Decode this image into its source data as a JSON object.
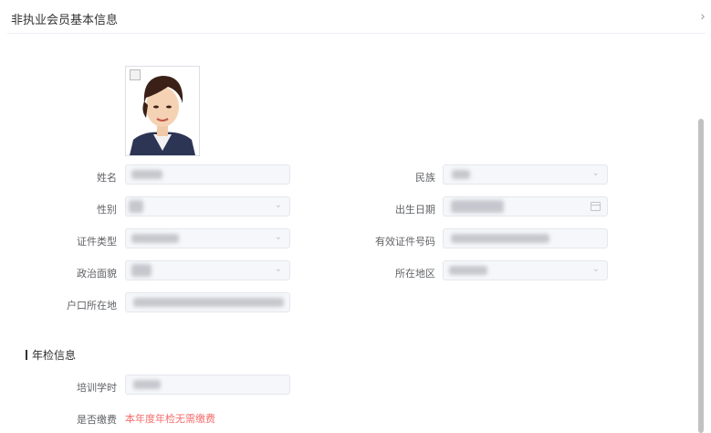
{
  "header": {
    "title": "非执业会员基本信息",
    "collapse_icon": "chevron-right-icon"
  },
  "photo": {
    "alt": "",
    "icon": "member-photo"
  },
  "fields": {
    "name": {
      "label": "姓名"
    },
    "ethnicity": {
      "label": "民族"
    },
    "gender": {
      "label": "性别"
    },
    "birth_date": {
      "label": "出生日期"
    },
    "id_type": {
      "label": "证件类型"
    },
    "id_number": {
      "label": "有效证件号码"
    },
    "political_status": {
      "label": "政治面貌"
    },
    "region": {
      "label": "所在地区"
    },
    "household_registration": {
      "label": "户口所在地"
    }
  },
  "annual_check": {
    "title": "年检信息",
    "training_hours": {
      "label": "培训学时"
    },
    "fee_paid": {
      "label": "是否缴费",
      "value": "本年度年检无需缴费",
      "color": "#f56c6c"
    }
  }
}
